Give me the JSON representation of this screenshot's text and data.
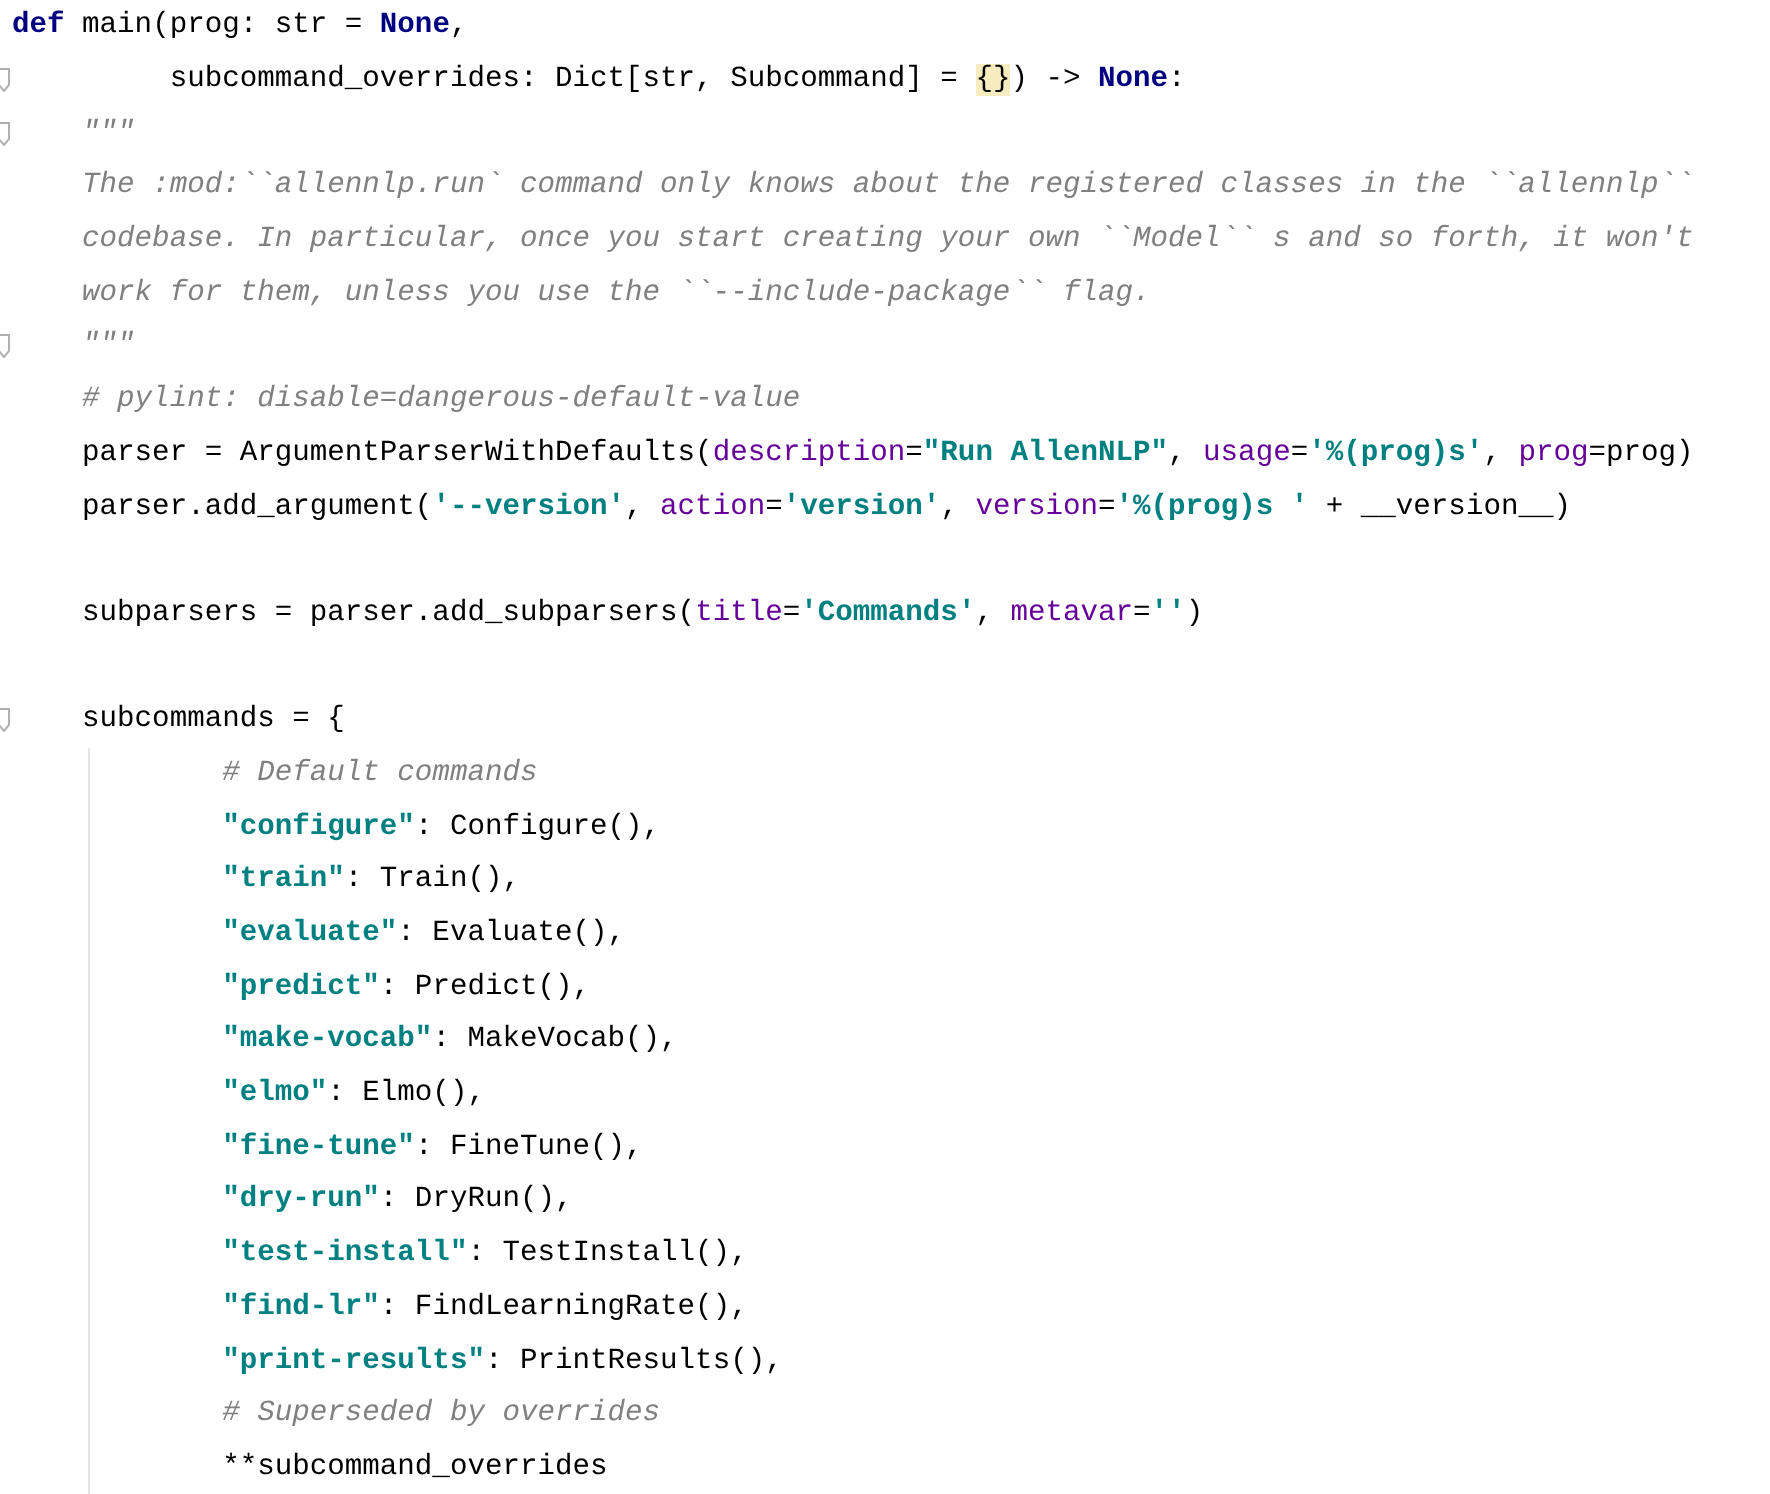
{
  "editor": {
    "lines": [
      {
        "fold": false,
        "tokens": [
          {
            "text": "def",
            "kind": "keyword"
          },
          {
            "text": " main(prog: str = ",
            "kind": "plain"
          },
          {
            "text": "None",
            "kind": "keyword"
          },
          {
            "text": ",",
            "kind": "plain"
          }
        ]
      },
      {
        "fold": true,
        "tokens": [
          {
            "text": "         subcommand_overrides: Dict[str, Subcommand] = ",
            "kind": "plain"
          },
          {
            "text": "{}",
            "kind": "match"
          },
          {
            "text": ") -> ",
            "kind": "plain"
          },
          {
            "text": "None",
            "kind": "keyword"
          },
          {
            "text": ":",
            "kind": "plain"
          }
        ]
      },
      {
        "fold": true,
        "tokens": [
          {
            "text": "    \"\"\"",
            "kind": "doc"
          }
        ]
      },
      {
        "fold": false,
        "tokens": [
          {
            "text": "    The :mod:``allennlp.run` command only knows about the registered classes in the ``allennlp``",
            "kind": "doc"
          }
        ]
      },
      {
        "fold": false,
        "tokens": [
          {
            "text": "    codebase. In particular, once you start creating your own ``Model`` s and so forth, it won't",
            "kind": "doc"
          }
        ]
      },
      {
        "fold": false,
        "tokens": [
          {
            "text": "    work for them, unless you use the ``--include-package`` flag.",
            "kind": "doc"
          }
        ]
      },
      {
        "fold": true,
        "tokens": [
          {
            "text": "    \"\"\"",
            "kind": "doc"
          }
        ]
      },
      {
        "fold": false,
        "tokens": [
          {
            "text": "    # pylint: disable=dangerous-default-value",
            "kind": "comment"
          }
        ]
      },
      {
        "fold": false,
        "tokens": [
          {
            "text": "    parser = ArgumentParserWithDefaults(",
            "kind": "plain"
          },
          {
            "text": "description",
            "kind": "param"
          },
          {
            "text": "=",
            "kind": "plain"
          },
          {
            "text": "\"Run AllenNLP\"",
            "kind": "string"
          },
          {
            "text": ", ",
            "kind": "plain"
          },
          {
            "text": "usage",
            "kind": "param"
          },
          {
            "text": "=",
            "kind": "plain"
          },
          {
            "text": "'%(prog)s'",
            "kind": "string"
          },
          {
            "text": ", ",
            "kind": "plain"
          },
          {
            "text": "prog",
            "kind": "param"
          },
          {
            "text": "=prog)",
            "kind": "plain"
          }
        ]
      },
      {
        "fold": false,
        "tokens": [
          {
            "text": "    parser.add_argument(",
            "kind": "plain"
          },
          {
            "text": "'--version'",
            "kind": "string"
          },
          {
            "text": ", ",
            "kind": "plain"
          },
          {
            "text": "action",
            "kind": "param"
          },
          {
            "text": "=",
            "kind": "plain"
          },
          {
            "text": "'version'",
            "kind": "string"
          },
          {
            "text": ", ",
            "kind": "plain"
          },
          {
            "text": "version",
            "kind": "param"
          },
          {
            "text": "=",
            "kind": "plain"
          },
          {
            "text": "'%(prog)s '",
            "kind": "string"
          },
          {
            "text": " + __version__)",
            "kind": "plain"
          }
        ]
      },
      {
        "fold": false
      },
      {
        "fold": false,
        "tokens": [
          {
            "text": "    subparsers = parser.add_subparsers(",
            "kind": "plain"
          },
          {
            "text": "title",
            "kind": "param"
          },
          {
            "text": "=",
            "kind": "plain"
          },
          {
            "text": "'Commands'",
            "kind": "string"
          },
          {
            "text": ", ",
            "kind": "plain"
          },
          {
            "text": "metavar",
            "kind": "param"
          },
          {
            "text": "=",
            "kind": "plain"
          },
          {
            "text": "''",
            "kind": "string"
          },
          {
            "text": ")",
            "kind": "plain"
          }
        ]
      },
      {
        "fold": false
      },
      {
        "fold": true,
        "tokens": [
          {
            "text": "    subcommands = {",
            "kind": "plain"
          }
        ],
        "children": [
          {
            "fold": false,
            "tokens": [
              {
                "text": "            # Default commands",
                "kind": "comment"
              }
            ]
          },
          {
            "fold": false,
            "tokens": [
              {
                "text": "            \"configure\"",
                "kind": "string"
              },
              {
                "text": ": Configure(),",
                "kind": "plain"
              }
            ]
          },
          {
            "fold": false,
            "tokens": [
              {
                "text": "            \"train\"",
                "kind": "string"
              },
              {
                "text": ": Train(),",
                "kind": "plain"
              }
            ]
          },
          {
            "fold": false,
            "tokens": [
              {
                "text": "            \"evaluate\"",
                "kind": "string"
              },
              {
                "text": ": Evaluate(),",
                "kind": "plain"
              }
            ]
          },
          {
            "fold": false,
            "tokens": [
              {
                "text": "            \"predict\"",
                "kind": "string"
              },
              {
                "text": ": Predict(),",
                "kind": "plain"
              }
            ]
          },
          {
            "fold": false,
            "tokens": [
              {
                "text": "            \"make-vocab\"",
                "kind": "string"
              },
              {
                "text": ": MakeVocab(),",
                "kind": "plain"
              }
            ]
          },
          {
            "fold": false,
            "tokens": [
              {
                "text": "            \"elmo\"",
                "kind": "string"
              },
              {
                "text": ": Elmo(),",
                "kind": "plain"
              }
            ]
          },
          {
            "fold": false,
            "tokens": [
              {
                "text": "            \"fine-tune\"",
                "kind": "string"
              },
              {
                "text": ": FineTune(),",
                "kind": "plain"
              }
            ]
          },
          {
            "fold": false,
            "tokens": [
              {
                "text": "            \"dry-run\"",
                "kind": "string"
              },
              {
                "text": ": DryRun(),",
                "kind": "plain"
              }
            ]
          },
          {
            "fold": false,
            "tokens": [
              {
                "text": "            \"test-install\"",
                "kind": "string"
              },
              {
                "text": ": TestInstall(),",
                "kind": "plain"
              }
            ]
          },
          {
            "fold": false,
            "tokens": [
              {
                "text": "            \"find-lr\"",
                "kind": "string"
              },
              {
                "text": ": FindLearningRate(),",
                "kind": "plain"
              }
            ]
          },
          {
            "fold": false,
            "tokens": [
              {
                "text": "            \"print-results\"",
                "kind": "string"
              },
              {
                "text": ": PrintResults(),",
                "kind": "plain"
              }
            ]
          },
          {
            "fold": false,
            "tokens": [
              {
                "text": "            # Superseded by overrides",
                "kind": "comment"
              }
            ]
          },
          {
            "fold": false,
            "tokens": [
              {
                "text": "            **subcommand_overrides",
                "kind": "plain"
              }
            ]
          }
        ]
      }
    ]
  }
}
